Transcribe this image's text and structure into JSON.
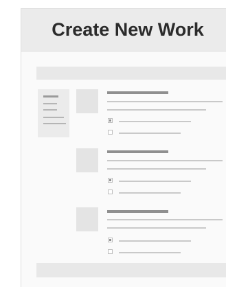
{
  "header": {
    "title": "Create New Work"
  },
  "sidebar": {
    "item_count": 5
  },
  "work_items": [
    {
      "options": [
        {
          "checked": true
        },
        {
          "checked": false
        }
      ]
    },
    {
      "options": [
        {
          "checked": true
        },
        {
          "checked": false
        }
      ]
    },
    {
      "options": [
        {
          "checked": true
        },
        {
          "checked": false
        }
      ]
    }
  ]
}
